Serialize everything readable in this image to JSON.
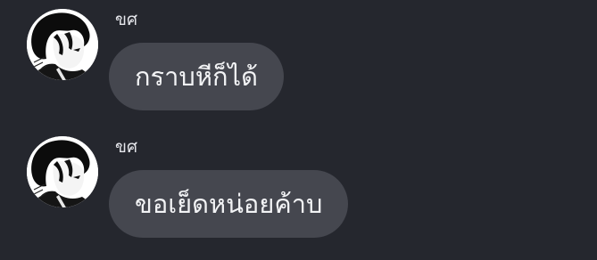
{
  "messages": [
    {
      "sender": "ขศ",
      "text": "กราบหีก็ได้",
      "avatar_icon": "profile-avatar"
    },
    {
      "sender": "ขศ",
      "text": "ขอเย็ดหน่อยค้าบ",
      "avatar_icon": "profile-avatar"
    }
  ],
  "colors": {
    "background": "#25272e",
    "bubble": "#45474f",
    "text": "#f2f3f5",
    "sender": "#e4e5ea"
  }
}
